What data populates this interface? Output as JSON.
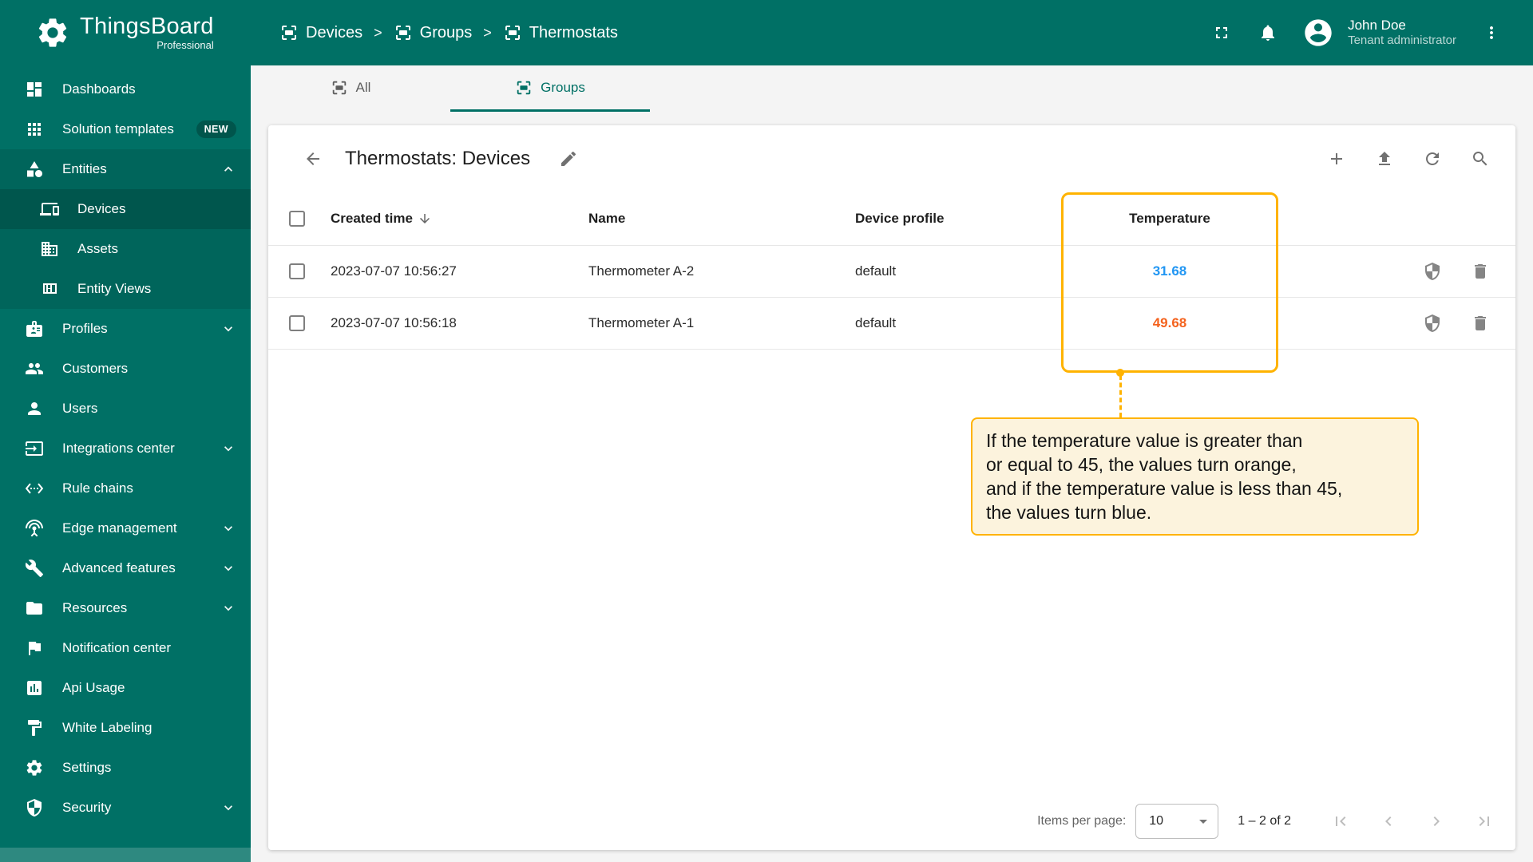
{
  "app": {
    "logo_title": "ThingsBoard",
    "logo_subtitle": "Professional"
  },
  "header": {
    "separator": ">",
    "breadcrumb": [
      {
        "label": "Devices",
        "icon": "devices-group-icon"
      },
      {
        "label": "Groups",
        "icon": "devices-group-icon"
      },
      {
        "label": "Thermostats",
        "icon": "devices-group-icon"
      }
    ],
    "actions": [
      {
        "name": "fullscreen",
        "icon": "fullscreen-icon"
      },
      {
        "name": "notifications",
        "icon": "bell-icon"
      }
    ],
    "user": {
      "name": "John Doe",
      "role": "Tenant administrator",
      "icon": "avatar-icon"
    },
    "menu_icon": "kebab-menu-icon"
  },
  "sidebar": {
    "items": [
      {
        "label": "Dashboards",
        "icon": "dashboards-icon"
      },
      {
        "label": "Solution templates",
        "icon": "solution-templates-icon",
        "badge": "NEW"
      },
      {
        "label": "Entities",
        "icon": "entities-icon",
        "state": "expanded"
      },
      {
        "label": "Devices",
        "icon": "devices-icon",
        "selected": true
      },
      {
        "label": "Assets",
        "icon": "assets-icon"
      },
      {
        "label": "Entity Views",
        "icon": "entity-views-icon"
      },
      {
        "label": "Profiles",
        "icon": "profiles-icon",
        "state": "collapsed"
      },
      {
        "label": "Customers",
        "icon": "customers-icon"
      },
      {
        "label": "Users",
        "icon": "users-icon"
      },
      {
        "label": "Integrations center",
        "icon": "integrations-center-icon",
        "state": "collapsed"
      },
      {
        "label": "Rule chains",
        "icon": "rule-chains-icon"
      },
      {
        "label": "Edge management",
        "icon": "edge-management-icon",
        "state": "collapsed"
      },
      {
        "label": "Advanced features",
        "icon": "advanced-features-icon",
        "state": "collapsed"
      },
      {
        "label": "Resources",
        "icon": "resources-icon",
        "state": "collapsed"
      },
      {
        "label": "Notification center",
        "icon": "notification-center-icon"
      },
      {
        "label": "Api Usage",
        "icon": "api-usage-icon"
      },
      {
        "label": "White Labeling",
        "icon": "white-labeling-icon"
      },
      {
        "label": "Settings",
        "icon": "settings-icon"
      },
      {
        "label": "Security",
        "icon": "security-icon",
        "state": "collapsed"
      }
    ]
  },
  "tabs": [
    {
      "label": "All",
      "icon": "devices-group-icon"
    },
    {
      "label": "Groups",
      "icon": "devices-group-icon",
      "active": true
    }
  ],
  "table_card": {
    "title": "Thermostats: Devices",
    "actions": [
      {
        "name": "add",
        "icon": "plus-icon"
      },
      {
        "name": "import",
        "icon": "upload-icon"
      },
      {
        "name": "refresh",
        "icon": "refresh-icon"
      },
      {
        "name": "search",
        "icon": "search-icon"
      }
    ],
    "columns": {
      "created_time": "Created time",
      "name": "Name",
      "device_profile": "Device profile",
      "temperature": "Temperature"
    },
    "rows": [
      {
        "created_time": "2023-07-07 10:56:27",
        "name": "Thermometer A-2",
        "device_profile": "default",
        "temperature": "31.68",
        "temp_state": "blue"
      },
      {
        "created_time": "2023-07-07 10:56:18",
        "name": "Thermometer A-1",
        "device_profile": "default",
        "temperature": "49.68",
        "temp_state": "orange"
      }
    ],
    "row_actions": [
      {
        "name": "security",
        "icon": "shield-icon"
      },
      {
        "name": "delete",
        "icon": "trash-icon"
      }
    ]
  },
  "annotation": {
    "lines": [
      "If the temperature value is greater than",
      "or equal to 45, the values turn orange,",
      "and if the temperature value is less than 45,",
      "the values turn blue."
    ]
  },
  "pagination": {
    "items_per_page_label": "Items per page:",
    "items_per_page_value": "10",
    "range_label": "1 – 2 of 2"
  },
  "colors": {
    "primary_teal": "#007065",
    "sidebar_selected": "#00564D",
    "temperature_blue": "#2196F3",
    "temperature_orange": "#F4621D",
    "highlight_amber": "#FFB300",
    "annotation_bg": "#FCF3DD"
  }
}
